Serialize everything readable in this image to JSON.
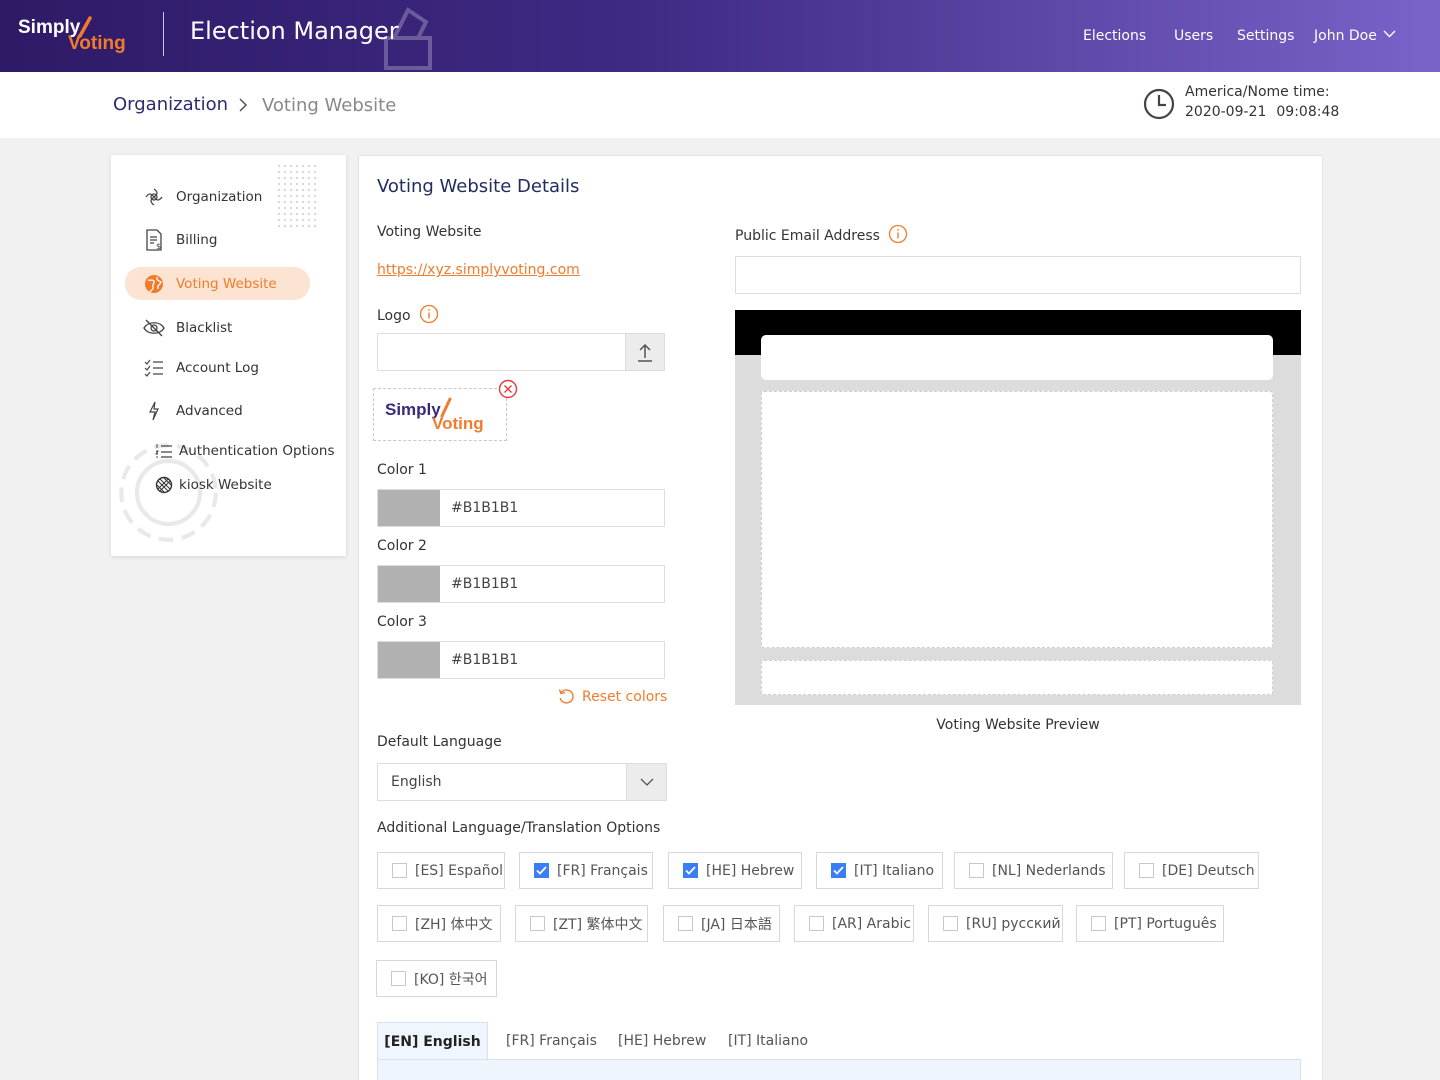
{
  "header": {
    "logo_simply": "Simply",
    "logo_voting": "Voting",
    "app_title": "Election Manager",
    "nav": {
      "elections": "Elections",
      "users": "Users",
      "settings": "Settings",
      "user_name": "John Doe"
    }
  },
  "breadcrumb": {
    "parent": "Organization",
    "current": "Voting Website"
  },
  "timezone": {
    "label": "America/Nome time:",
    "date": "2020-09-21",
    "time": "09:08:48"
  },
  "sidebar": {
    "items": [
      {
        "label": "Organization",
        "icon": "organization-icon"
      },
      {
        "label": "Billing",
        "icon": "billing-icon"
      },
      {
        "label": "Voting Website",
        "icon": "globe-icon",
        "active": true
      },
      {
        "label": "Blacklist",
        "icon": "eye-slash-icon"
      },
      {
        "label": "Account Log",
        "icon": "checklist-icon"
      },
      {
        "label": "Advanced",
        "icon": "lightning-icon"
      },
      {
        "label": "Authentication Options",
        "icon": "numbered-list-icon"
      },
      {
        "label": "kiosk Website",
        "icon": "kiosk-icon"
      }
    ]
  },
  "main": {
    "title": "Voting Website Details",
    "voting_website_label": "Voting Website",
    "voting_website_url": "https://xyz.simplyvoting.com",
    "logo_label": "Logo",
    "logo_file_value": "",
    "logo_preview_simply": "Simply",
    "logo_preview_voting": "Voting",
    "colors": [
      {
        "label": "Color 1",
        "value": "#B1B1B1"
      },
      {
        "label": "Color 2",
        "value": "#B1B1B1"
      },
      {
        "label": "Color 3",
        "value": "#B1B1B1"
      }
    ],
    "reset_colors": "Reset colors",
    "default_language_label": "Default Language",
    "default_language_value": "English",
    "public_email_label": "Public Email Address",
    "public_email_value": "",
    "preview_caption": "Voting Website Preview",
    "additional_languages_label": "Additional Language/Translation Options",
    "languages": [
      {
        "label": "[ES] Español",
        "checked": false
      },
      {
        "label": "[FR] Français",
        "checked": true
      },
      {
        "label": "[HE] Hebrew",
        "checked": true
      },
      {
        "label": "[IT] Italiano",
        "checked": true
      },
      {
        "label": "[NL] Nederlands",
        "checked": false
      },
      {
        "label": "[DE] Deutsch",
        "checked": false
      },
      {
        "label": "[ZH] 体中文",
        "checked": false
      },
      {
        "label": "[ZT] 繁体中文",
        "checked": false
      },
      {
        "label": "[JA] 日本語",
        "checked": false
      },
      {
        "label": "[AR] Arabic",
        "checked": false
      },
      {
        "label": "[RU] русский",
        "checked": false
      },
      {
        "label": "[PT] Português",
        "checked": false
      },
      {
        "label": "[KO] 한국어",
        "checked": false
      }
    ],
    "tabs": [
      {
        "label": "[EN] English",
        "active": true
      },
      {
        "label": "[FR] Français"
      },
      {
        "label": "[HE] Hebrew"
      },
      {
        "label": "[IT] Italiano"
      }
    ]
  },
  "colors": {
    "accent": "#f07c2c",
    "brand_dark": "#2e1a66",
    "brand_light": "#7a63c9",
    "checkbox_on": "#3a7df5",
    "active_bg": "#fde3d2"
  }
}
